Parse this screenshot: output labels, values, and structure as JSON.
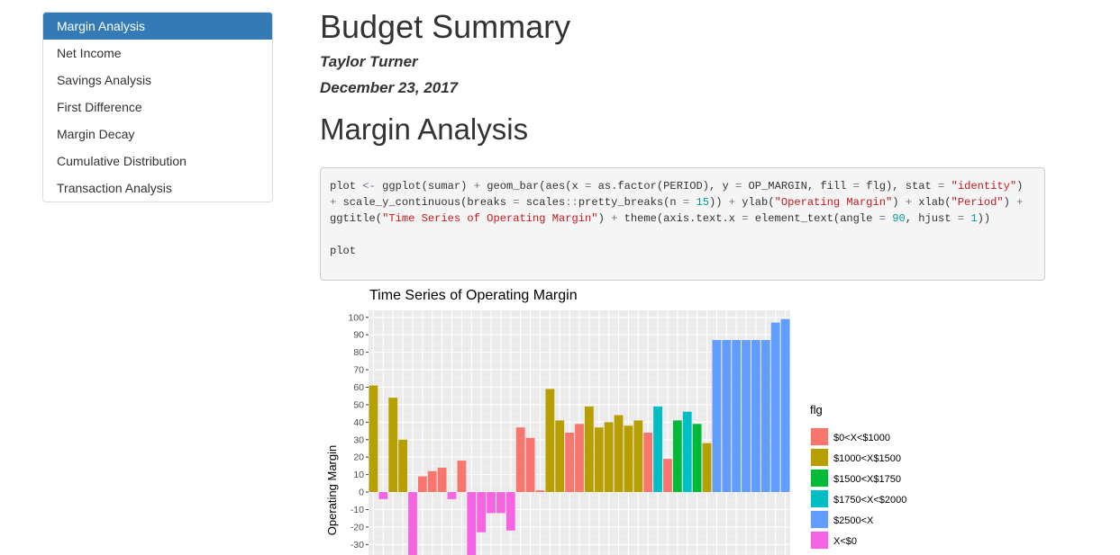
{
  "toc": {
    "items": [
      {
        "label": "Margin Analysis",
        "active": true
      },
      {
        "label": "Net Income",
        "active": false
      },
      {
        "label": "Savings Analysis",
        "active": false
      },
      {
        "label": "First Difference",
        "active": false
      },
      {
        "label": "Margin Decay",
        "active": false
      },
      {
        "label": "Cumulative Distribution",
        "active": false
      },
      {
        "label": "Transaction Analysis",
        "active": false
      }
    ]
  },
  "doc": {
    "title": "Budget Summary",
    "author": "Taylor Turner",
    "date": "December 23, 2017"
  },
  "section": {
    "title": "Margin Analysis",
    "code": [
      {
        "t": "plain",
        "v": "plot "
      },
      {
        "t": "op",
        "v": "<-"
      },
      {
        "t": "plain",
        "v": " ggplot(sumar) "
      },
      {
        "t": "op",
        "v": "+"
      },
      {
        "t": "plain",
        "v": " geom_bar(aes(x "
      },
      {
        "t": "op",
        "v": "="
      },
      {
        "t": "plain",
        "v": " as.factor(PERIOD), y "
      },
      {
        "t": "op",
        "v": "="
      },
      {
        "t": "plain",
        "v": " OP_MARGIN, fill "
      },
      {
        "t": "op",
        "v": "="
      },
      {
        "t": "plain",
        "v": " flg), stat "
      },
      {
        "t": "op",
        "v": "="
      },
      {
        "t": "plain",
        "v": " "
      },
      {
        "t": "str",
        "v": "\"identity\""
      },
      {
        "t": "plain",
        "v": ") "
      },
      {
        "t": "op",
        "v": "+"
      },
      {
        "t": "plain",
        "v": " scale_y_continuous(breaks "
      },
      {
        "t": "op",
        "v": "="
      },
      {
        "t": "plain",
        "v": " scales"
      },
      {
        "t": "op",
        "v": "::"
      },
      {
        "t": "plain",
        "v": "pretty_breaks(n "
      },
      {
        "t": "op",
        "v": "="
      },
      {
        "t": "plain",
        "v": " "
      },
      {
        "t": "num",
        "v": "15"
      },
      {
        "t": "plain",
        "v": ")) "
      },
      {
        "t": "op",
        "v": "+"
      },
      {
        "t": "plain",
        "v": " ylab("
      },
      {
        "t": "str",
        "v": "\"Operating Margin\""
      },
      {
        "t": "plain",
        "v": ") "
      },
      {
        "t": "op",
        "v": "+"
      },
      {
        "t": "plain",
        "v": " xlab("
      },
      {
        "t": "str",
        "v": "\"Period\""
      },
      {
        "t": "plain",
        "v": ") "
      },
      {
        "t": "op",
        "v": "+"
      },
      {
        "t": "plain",
        "v": " ggtitle("
      },
      {
        "t": "str",
        "v": "\"Time Series of Operating Margin\""
      },
      {
        "t": "plain",
        "v": ") "
      },
      {
        "t": "op",
        "v": "+"
      },
      {
        "t": "plain",
        "v": " theme(axis.text.x "
      },
      {
        "t": "op",
        "v": "="
      },
      {
        "t": "plain",
        "v": " element_text(angle "
      },
      {
        "t": "op",
        "v": "="
      },
      {
        "t": "plain",
        "v": " "
      },
      {
        "t": "num",
        "v": "90"
      },
      {
        "t": "plain",
        "v": ", hjust "
      },
      {
        "t": "op",
        "v": "="
      },
      {
        "t": "plain",
        "v": " "
      },
      {
        "t": "num",
        "v": "1"
      },
      {
        "t": "plain",
        "v": "))\n\nplot"
      }
    ]
  },
  "colors": {
    "$0<X<$1000": "#F8766D",
    "$1000<X$1500": "#B79F00",
    "$1500<X$1750": "#00BA38",
    "$1750<X<$2000": "#00BFC4",
    "$2500<X": "#619CFF",
    "X<$0": "#F564E3",
    "accent": "#337ab7"
  },
  "chart_data": {
    "type": "bar",
    "title": "Time Series of Operating Margin",
    "ylabel": "Operating Margin",
    "xlabel": "",
    "legend_title": "flg",
    "legend": [
      "$0<X<$1000",
      "$1000<X$1500",
      "$1500<X$1750",
      "$1750<X<$2000",
      "$2500<X",
      "X<$0"
    ],
    "y_ticks": [
      100,
      90,
      80,
      70,
      60,
      50,
      40,
      30,
      20,
      10,
      0,
      -10,
      -20,
      -30
    ],
    "ylim": [
      -36,
      104
    ],
    "grid": true,
    "legend_position": "right",
    "bars": [
      {
        "v": 61,
        "g": "$1000<X$1500"
      },
      {
        "v": -4,
        "g": "X<$0"
      },
      {
        "v": 54,
        "g": "$1000<X$1500"
      },
      {
        "v": 30,
        "g": "$1000<X$1500"
      },
      {
        "v": -36,
        "g": "X<$0"
      },
      {
        "v": 9,
        "g": "$0<X<$1000"
      },
      {
        "v": 12,
        "g": "$0<X<$1000"
      },
      {
        "v": 14,
        "g": "$0<X<$1000"
      },
      {
        "v": -4,
        "g": "X<$0"
      },
      {
        "v": 18,
        "g": "$0<X<$1000"
      },
      {
        "v": -36,
        "g": "X<$0"
      },
      {
        "v": -23,
        "g": "X<$0"
      },
      {
        "v": -12,
        "g": "X<$0"
      },
      {
        "v": -12,
        "g": "X<$0"
      },
      {
        "v": -22,
        "g": "X<$0"
      },
      {
        "v": 37,
        "g": "$0<X<$1000"
      },
      {
        "v": 31,
        "g": "$0<X<$1000"
      },
      {
        "v": 1,
        "g": "$0<X<$1000"
      },
      {
        "v": 59,
        "g": "$1000<X$1500"
      },
      {
        "v": 41,
        "g": "$1000<X$1500"
      },
      {
        "v": 34,
        "g": "$0<X<$1000"
      },
      {
        "v": 39,
        "g": "$0<X<$1000"
      },
      {
        "v": 49,
        "g": "$1000<X$1500"
      },
      {
        "v": 37,
        "g": "$1000<X$1500"
      },
      {
        "v": 40,
        "g": "$1000<X$1500"
      },
      {
        "v": 44,
        "g": "$1000<X$1500"
      },
      {
        "v": 38,
        "g": "$1000<X$1500"
      },
      {
        "v": 41,
        "g": "$1000<X$1500"
      },
      {
        "v": 34,
        "g": "$0<X<$1000"
      },
      {
        "v": 49,
        "g": "$1750<X<$2000"
      },
      {
        "v": 19,
        "g": "$0<X<$1000"
      },
      {
        "v": 41,
        "g": "$1500<X$1750"
      },
      {
        "v": 46,
        "g": "$1750<X<$2000"
      },
      {
        "v": 39,
        "g": "$1500<X$1750"
      },
      {
        "v": 28,
        "g": "$1000<X$1500"
      },
      {
        "v": 87,
        "g": "$2500<X"
      },
      {
        "v": 87,
        "g": "$2500<X"
      },
      {
        "v": 87,
        "g": "$2500<X"
      },
      {
        "v": 87,
        "g": "$2500<X"
      },
      {
        "v": 87,
        "g": "$2500<X"
      },
      {
        "v": 87,
        "g": "$2500<X"
      },
      {
        "v": 97,
        "g": "$2500<X"
      },
      {
        "v": 99,
        "g": "$2500<X"
      }
    ]
  }
}
